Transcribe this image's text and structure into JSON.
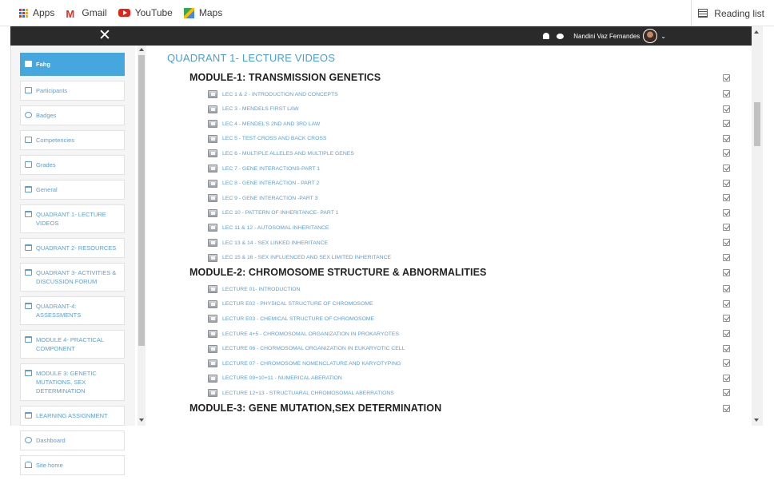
{
  "bookmarks": {
    "items": [
      {
        "label": "Apps",
        "icon": "apps-icon"
      },
      {
        "label": "Gmail",
        "icon": "gmail-icon"
      },
      {
        "label": "YouTube",
        "icon": "youtube-icon"
      },
      {
        "label": "Maps",
        "icon": "maps-icon"
      }
    ],
    "reading_list": "Reading list"
  },
  "navbar": {
    "close_glyph": "✕",
    "user_name": "Nandini Vaz Fernandes"
  },
  "sidebar": {
    "items": [
      {
        "label": "Fahg",
        "icon": "course-icon",
        "active": true
      },
      {
        "label": "Participants",
        "icon": "participants-icon"
      },
      {
        "label": "Badges",
        "icon": "badge-icon"
      },
      {
        "label": "Competencies",
        "icon": "competencies-icon"
      },
      {
        "label": "Grades",
        "icon": "grades-icon"
      },
      {
        "label": "General",
        "icon": "folder-icon"
      },
      {
        "label": "QUADRANT 1- LECTURE VIDEOS",
        "icon": "folder-icon"
      },
      {
        "label": "QUADRANT 2- RESOURCES",
        "icon": "folder-icon"
      },
      {
        "label": "QUADRANT 3- ACTIVITIES & DISCUSSION FORUM",
        "icon": "folder-icon"
      },
      {
        "label": "QUADRANT-4: ASSESSMENTS",
        "icon": "folder-icon"
      },
      {
        "label": "MODULE 4- PRACTICAL COMPONENT",
        "icon": "folder-icon"
      },
      {
        "label": "MODULE 3: GENETIC MUTATIONS, SEX DETERMINATION",
        "icon": "folder-icon"
      },
      {
        "label": "LEARNING ASSIGNMENT",
        "icon": "folder-icon"
      },
      {
        "label": "Dashboard",
        "icon": "dashboard-icon"
      },
      {
        "label": "Site home",
        "icon": "home-icon"
      }
    ]
  },
  "main": {
    "section_title": "QUADRANT 1- LECTURE VIDEOS",
    "modules": [
      {
        "title": "MODULE-1: TRANSMISSION GENETICS",
        "lectures": [
          "LEC 1 & 2 - INTRODUCTION AND CONCEPTS",
          "LEC 3 - MENDELS FIRST LAW",
          "LEC 4 - MENDEL'S 2ND AND 3RD LAW",
          "LEC 5 - TEST CROSS AND BACK CROSS",
          "LEC 6 - MULTIPLE ALLELES AND MULTIPLE GENES",
          "LEC 7 - GENE INTERACTIONS-PART 1",
          "LEC 8 - GENE INTERACTION - PART 2",
          "LEC 9 - GENE INTERACTION -PART 3",
          "LEC 10 - PATTERN OF INHERITANCE- PART 1",
          "LEC 11 & 12 - AUTOSOMAL INHERITANCE",
          "LEC 13 & 14 - SEX LINKED INHERITANCE",
          "LEC 15 & 16 - SEX INFLUENCED AND SEX LIMITED INHERITANCE"
        ]
      },
      {
        "title": "MODULE-2: CHROMOSOME STRUCTURE & ABNORMALITIES",
        "lectures": [
          "LECTURE 01- INTRODUCTION",
          "LECTUR E02 - PHYSICAL STRUCTURE OF CHROMOSOME",
          "LECTUR E03 - CHEMICAL STRUCTURE OF CHROMOSOME",
          "LECTURE 4+5 - CHROMOSOMAL ORGANIZATION IN PROKARYOTES",
          "LECTURE 06 - CHORMOSOMAL ORGANIZATION IN EUKARYOTIC CELL",
          "LECTURE 07 - CHROMOSOME NOMENCLATURE AND KARYOTYPING",
          "LECTURE 09+10+11 - NUMERICAL ABERATION",
          "LECTURE 12+13 - STRUCTUARAL CHROMOSOMAL ABERRATIONS"
        ]
      },
      {
        "title": "MODULE-3: GENE MUTATION,SEX DETERMINATION",
        "lectures": []
      }
    ]
  }
}
